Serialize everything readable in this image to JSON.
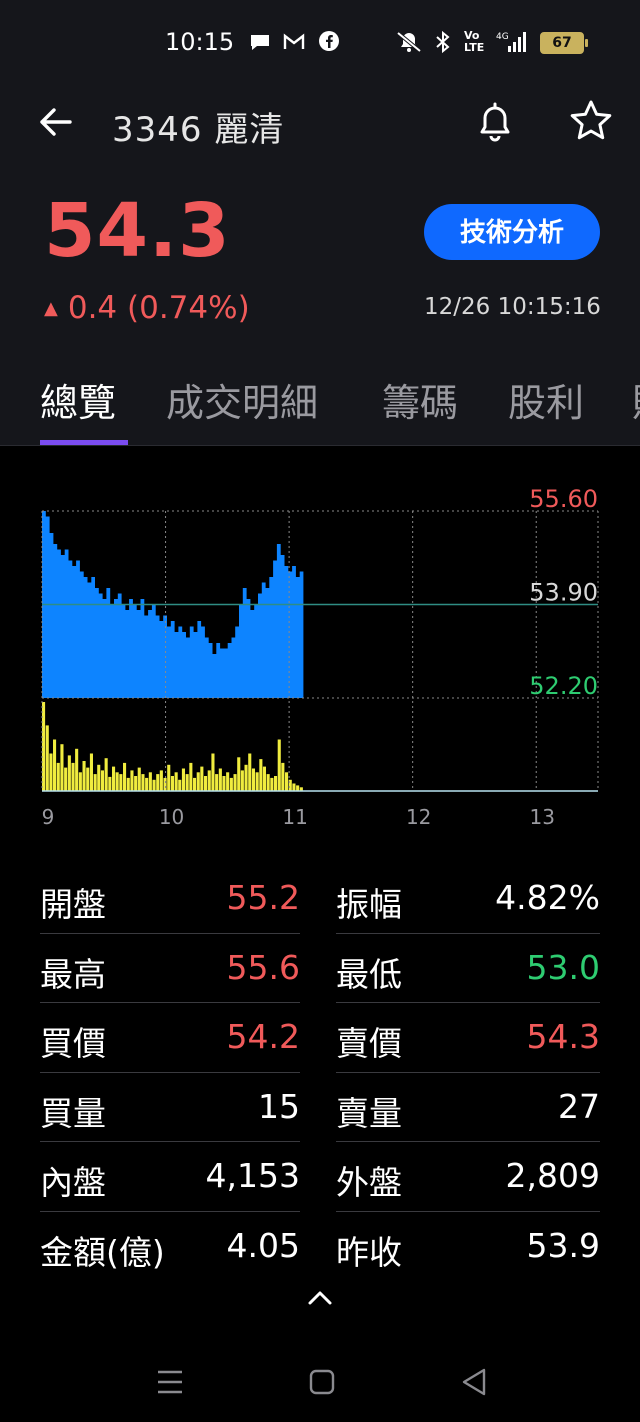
{
  "status_bar": {
    "time": "10:15",
    "battery": "67",
    "network": "4G"
  },
  "header": {
    "title": "3346 麗清",
    "icons": [
      "back-arrow-icon",
      "bell-icon",
      "star-icon"
    ]
  },
  "quote": {
    "price": "54.3",
    "change": "0.4 (0.74%)",
    "direction": "up",
    "tech_button": "技術分析",
    "timestamp": "12/26 10:15:16",
    "colors": {
      "up": "#f05a5a",
      "down": "#2ecc71",
      "accent": "#0f69ff",
      "tab_underline": "#7b4cf0"
    }
  },
  "tabs": [
    {
      "label": "總覽",
      "active": true
    },
    {
      "label": "成交明細",
      "active": false
    },
    {
      "label": "籌碼",
      "active": false
    },
    {
      "label": "股利",
      "active": false
    }
  ],
  "chart_data": {
    "type": "area",
    "y_labels": [
      "55.60",
      "53.90",
      "52.20"
    ],
    "y_label_colors": [
      "#f05a5a",
      "#d8d8d8",
      "#2ecc71"
    ],
    "ylim": [
      52.2,
      55.6
    ],
    "reference": 53.9,
    "x_ticks": [
      "9",
      "10",
      "11",
      "12",
      "13"
    ],
    "series": [
      {
        "type": "area",
        "color": "#0d84ff",
        "values": [
          55.6,
          55.5,
          55.2,
          55.0,
          54.9,
          54.8,
          54.9,
          54.7,
          54.6,
          54.7,
          54.5,
          54.4,
          54.3,
          54.4,
          54.2,
          54.1,
          54.0,
          54.2,
          53.9,
          54.0,
          54.1,
          53.9,
          53.8,
          54.0,
          53.9,
          53.8,
          54.0,
          53.7,
          53.8,
          53.9,
          53.7,
          53.6,
          53.7,
          53.5,
          53.6,
          53.4,
          53.5,
          53.4,
          53.3,
          53.5,
          53.4,
          53.6,
          53.5,
          53.3,
          53.2,
          53.0,
          53.2,
          53.1,
          53.1,
          53.2,
          53.3,
          53.5,
          53.9,
          54.2,
          54.0,
          53.8,
          53.9,
          54.1,
          54.3,
          54.2,
          54.4,
          54.7,
          55.0,
          54.8,
          54.6,
          54.5,
          54.6,
          54.4,
          54.5
        ]
      },
      {
        "type": "volume",
        "color": "#f0ec3f",
        "values": [
          95,
          70,
          40,
          55,
          30,
          50,
          25,
          38,
          30,
          45,
          20,
          32,
          25,
          40,
          18,
          28,
          22,
          35,
          15,
          26,
          20,
          18,
          30,
          14,
          22,
          16,
          25,
          18,
          14,
          20,
          12,
          18,
          22,
          14,
          28,
          16,
          20,
          12,
          24,
          18,
          30,
          14,
          20,
          26,
          16,
          22,
          40,
          18,
          24,
          16,
          20,
          14,
          18,
          36,
          22,
          28,
          40,
          24,
          20,
          34,
          26,
          18,
          14,
          16,
          55,
          30,
          20,
          12,
          8,
          6,
          4
        ]
      }
    ]
  },
  "stats": [
    {
      "left_label": "開盤",
      "left_value": "55.2",
      "left_color": "red",
      "right_label": "振幅",
      "right_value": "4.82%",
      "right_color": "white"
    },
    {
      "left_label": "最高",
      "left_value": "55.6",
      "left_color": "red",
      "right_label": "最低",
      "right_value": "53.0",
      "right_color": "green"
    },
    {
      "left_label": "買價",
      "left_value": "54.2",
      "left_color": "red",
      "right_label": "賣價",
      "right_value": "54.3",
      "right_color": "red"
    },
    {
      "left_label": "買量",
      "left_value": "15",
      "left_color": "white",
      "right_label": "賣量",
      "right_value": "27",
      "right_color": "white"
    },
    {
      "left_label": "內盤",
      "left_value": "4,153",
      "left_color": "white",
      "right_label": "外盤",
      "right_value": "2,809",
      "right_color": "white"
    },
    {
      "left_label": "金額(億)",
      "left_value": "4.05",
      "left_color": "white",
      "right_label": "昨收",
      "right_value": "53.9",
      "right_color": "white"
    }
  ],
  "bottom": {
    "expand_icon": "chevron-up-icon",
    "nav_icons": [
      "menu-icon",
      "home-icon",
      "back-icon"
    ]
  }
}
